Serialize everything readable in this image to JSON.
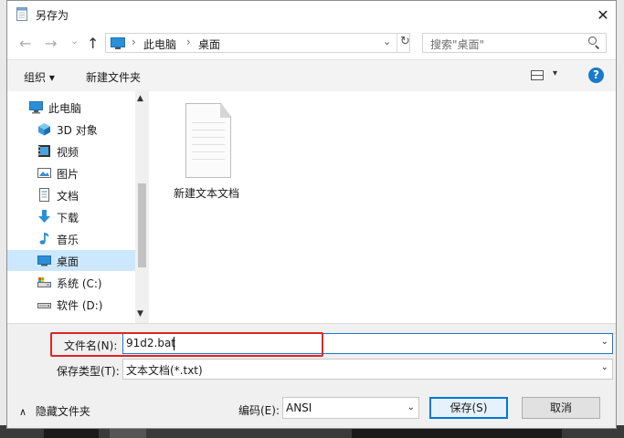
{
  "window": {
    "title": "另存为",
    "close_glyph": "✕"
  },
  "nav": {
    "back_glyph": "←",
    "forward_glyph": "→",
    "recent_glyph": "⌄",
    "up_glyph": "↑",
    "breadcrumb": [
      "此电脑",
      "桌面"
    ],
    "breadcrumb_sep": "›",
    "refresh_glyph": "↻",
    "dropdown_glyph": "⌄"
  },
  "search": {
    "placeholder": "搜索\"桌面\""
  },
  "toolbar": {
    "organize_label": "组织 ▾",
    "new_folder_label": "新建文件夹",
    "view_dd_glyph": "▾",
    "help_label": "?"
  },
  "navpane": {
    "items": [
      {
        "label": "此电脑",
        "icon": "computer-icon"
      },
      {
        "label": "3D 对象",
        "icon": "cube-3d-icon"
      },
      {
        "label": "视频",
        "icon": "video-icon"
      },
      {
        "label": "图片",
        "icon": "picture-icon"
      },
      {
        "label": "文档",
        "icon": "document-icon"
      },
      {
        "label": "下载",
        "icon": "download-arrow-icon"
      },
      {
        "label": "音乐",
        "icon": "music-note-icon"
      },
      {
        "label": "桌面",
        "icon": "desktop-icon",
        "selected": true
      },
      {
        "label": "系统 (C:)",
        "icon": "drive-c-icon"
      },
      {
        "label": "软件 (D:)",
        "icon": "drive-d-icon"
      }
    ],
    "scroll_up_glyph": "▲",
    "scroll_down_glyph": "▼"
  },
  "content": {
    "files": [
      {
        "name": "新建文本文档",
        "icon": "text-file-icon"
      }
    ]
  },
  "form": {
    "filename_label": "文件名(N):",
    "filename_value": "91d2.bat",
    "filetype_label": "保存类型(T):",
    "filetype_value": "文本文档(*.txt)",
    "encoding_label": "编码(E):",
    "encoding_value": "ANSI",
    "chevron_glyph": "⌄"
  },
  "buttons": {
    "hide_folders_label": "隐藏文件夹",
    "hide_folders_glyph": "∧",
    "save_label": "保存(S)",
    "cancel_label": "取消"
  },
  "colors": {
    "accent": "#1979ca",
    "highlight_box": "#e02424",
    "selection": "#cce8ff"
  }
}
